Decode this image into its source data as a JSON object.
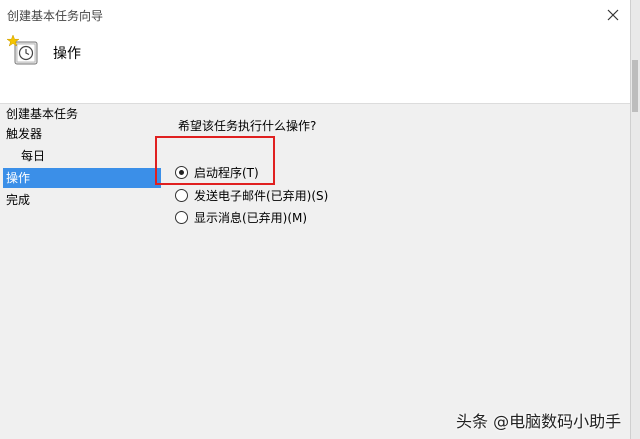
{
  "window": {
    "title": "创建基本任务向导"
  },
  "header": {
    "title": "操作",
    "icon": "task-clock-icon"
  },
  "sidebar": {
    "items": [
      {
        "label": "创建基本任务"
      },
      {
        "label": "触发器"
      },
      {
        "label": "每日"
      },
      {
        "label": "操作"
      },
      {
        "label": "完成"
      }
    ],
    "active_index": 3
  },
  "main": {
    "prompt": "希望该任务执行什么操作?",
    "options": [
      {
        "label": "启动程序(T)",
        "checked": true
      },
      {
        "label": "发送电子邮件(已弃用)(S)",
        "checked": false
      },
      {
        "label": "显示消息(已弃用)(M)",
        "checked": false
      }
    ]
  },
  "annotation": {
    "color": "#e02020"
  },
  "watermark": {
    "text": "头条 @电脑数码小助手"
  },
  "colors": {
    "selection": "#3b8fe8",
    "background": "#f0f0f0",
    "header": "#ffffff"
  }
}
